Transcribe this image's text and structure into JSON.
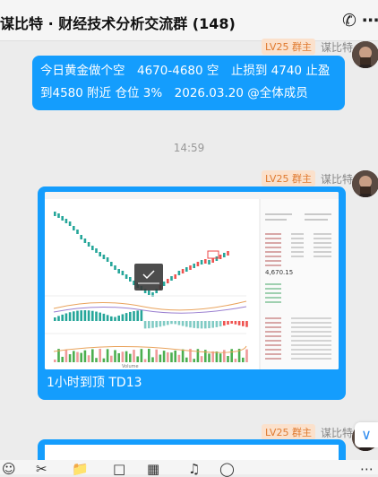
{
  "header": {
    "title": "谋比特 · 财经技术分析交流群 (148)",
    "call_icon": "phone-icon",
    "more_icon": "more-icon"
  },
  "messages": [
    {
      "level": "LV25 群主",
      "sender": "谋比特",
      "text_line1": "今日黄金做个空　4670-4680 空　止损到 4740  止盈",
      "text_line2": "到4580 附近 仓位 3%　2026.03.20 @全体成员"
    },
    {
      "time": "14:59",
      "level": "LV25 群主",
      "sender": "谋比特",
      "caption": "1小时到顶 TD13",
      "chart": {
        "price_label": "4,670.15",
        "volume_label": "Volume",
        "tooltip_icon": "check-icon"
      }
    },
    {
      "level": "LV25 群主",
      "sender": "谋比特"
    }
  ],
  "toolbar": {
    "icons": [
      "emoji-icon",
      "scissors-icon",
      "folder-icon",
      "message-icon",
      "chart-icon",
      "voice-icon",
      "more-icon"
    ]
  }
}
